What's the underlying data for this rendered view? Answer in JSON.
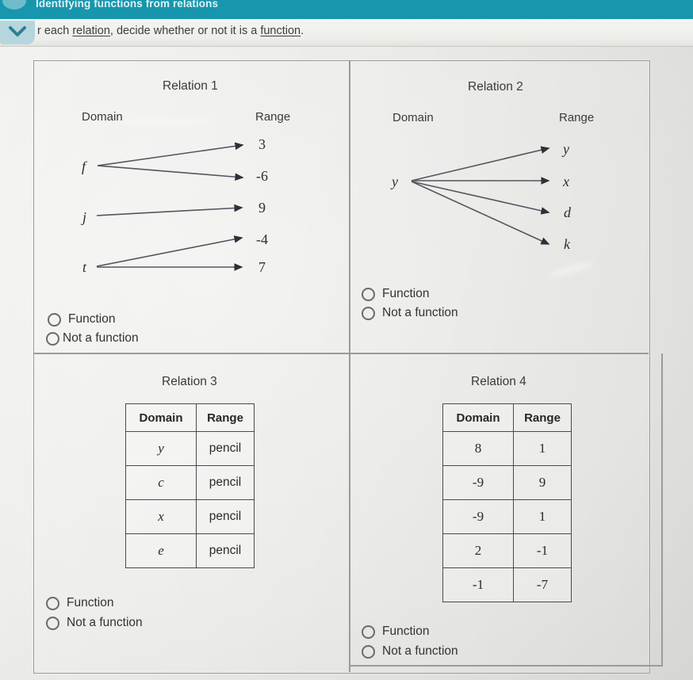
{
  "header": {
    "title": "Identifying functions from relations",
    "bar_color": "#1796ad",
    "chevron_icon": "chevron-down-icon"
  },
  "instruction": {
    "prefix": "r each ",
    "link1": "relation",
    "middle": ", decide whether or not it is a ",
    "link2": "function",
    "suffix": "."
  },
  "options": {
    "function": "Function",
    "not_a_function": "Not a function"
  },
  "labels": {
    "domain": "Domain",
    "range": "Range"
  },
  "relations": [
    {
      "title": "Relation 1",
      "type": "mapping",
      "domain": [
        "f",
        "j",
        "t"
      ],
      "range": [
        "3",
        "-6",
        "9",
        "-4",
        "7"
      ],
      "pairs": [
        [
          "f",
          "3"
        ],
        [
          "f",
          "-6"
        ],
        [
          "j",
          "9"
        ],
        [
          "t",
          "-4"
        ],
        [
          "t",
          "7"
        ]
      ]
    },
    {
      "title": "Relation 2",
      "type": "mapping",
      "domain": [
        "y"
      ],
      "range": [
        "y",
        "x",
        "d",
        "k"
      ],
      "pairs": [
        [
          "y",
          "y"
        ],
        [
          "y",
          "x"
        ],
        [
          "y",
          "d"
        ],
        [
          "y",
          "k"
        ]
      ]
    },
    {
      "title": "Relation 3",
      "type": "table",
      "headers": [
        "Domain",
        "Range"
      ],
      "rows": [
        [
          "y",
          "pencil"
        ],
        [
          "c",
          "pencil"
        ],
        [
          "x",
          "pencil"
        ],
        [
          "e",
          "pencil"
        ]
      ]
    },
    {
      "title": "Relation 4",
      "type": "table",
      "headers": [
        "Domain",
        "Range"
      ],
      "rows": [
        [
          "8",
          "1"
        ],
        [
          "-9",
          "9"
        ],
        [
          "-9",
          "1"
        ],
        [
          "2",
          "-1"
        ],
        [
          "-1",
          "-7"
        ]
      ]
    }
  ]
}
